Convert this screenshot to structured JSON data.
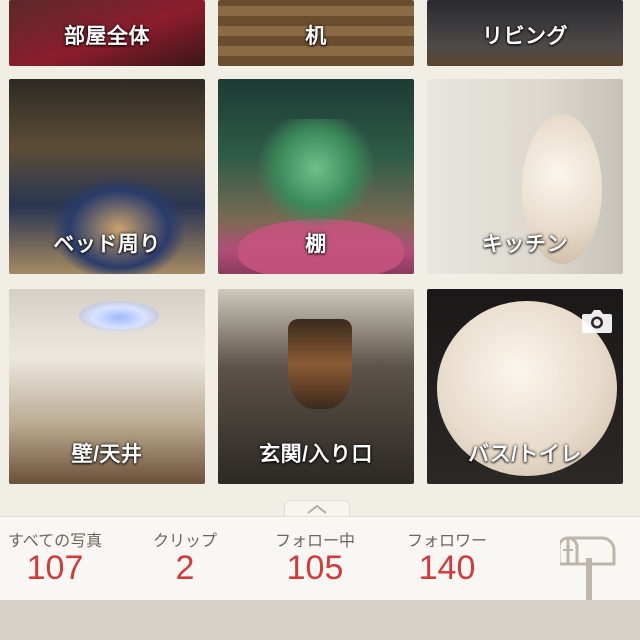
{
  "categories": {
    "row0": [
      "部屋全体",
      "机",
      "リビング"
    ],
    "row1": [
      "ベッド周り",
      "棚",
      "キッチン"
    ],
    "row2": [
      "壁/天井",
      "玄関/入り口",
      "バス/トイレ"
    ]
  },
  "stats": [
    {
      "label": "すべての写真",
      "value": "107"
    },
    {
      "label": "クリップ",
      "value": "2"
    },
    {
      "label": "フォロー中",
      "value": "105"
    },
    {
      "label": "フォロワー",
      "value": "140"
    }
  ],
  "colors": {
    "accent_number": "#d23b3b",
    "background": "#f1eee6"
  },
  "icons": [
    "camera-icon",
    "chevron-up-icon",
    "mailbox-icon"
  ]
}
